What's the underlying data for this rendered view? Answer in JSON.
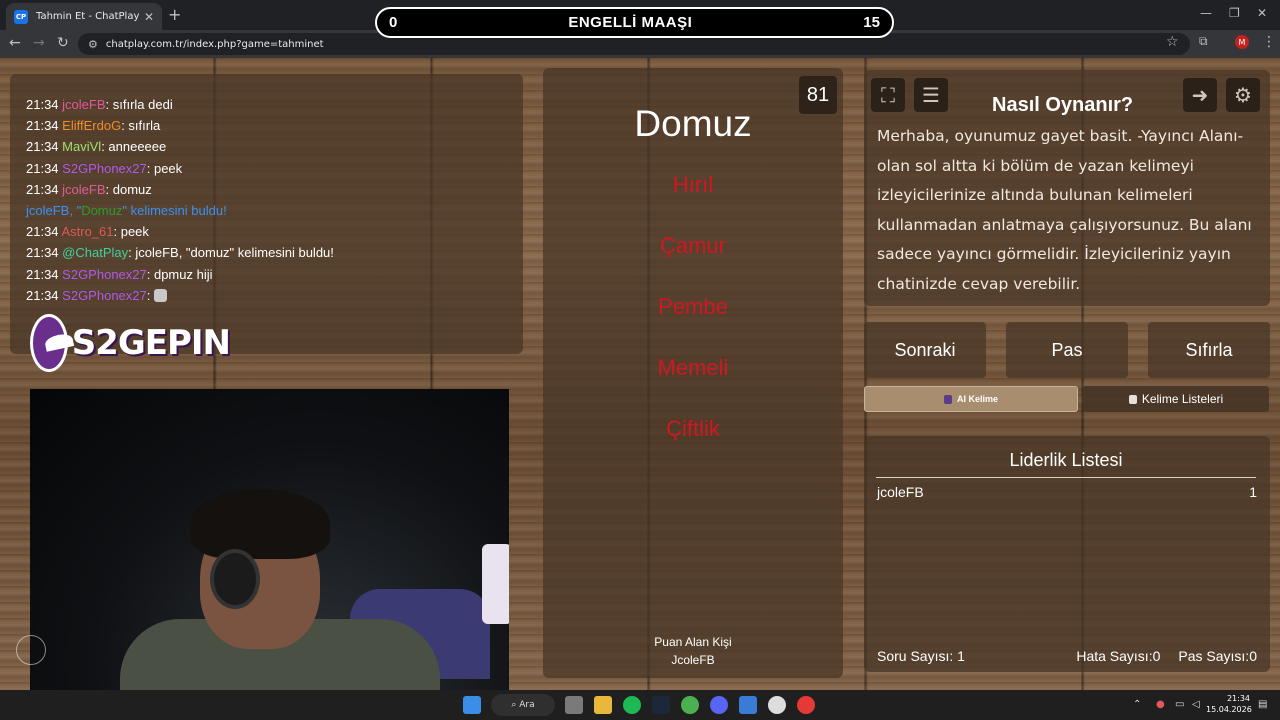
{
  "browser": {
    "tab_title": "Tahmin Et - ChatPlay",
    "tab_favicon": "CP",
    "url": "chatplay.com.tr/index.php?game=tahminet",
    "profile_initial": "M"
  },
  "banner": {
    "left_score": "0",
    "title": "ENGELLİ MAAŞI",
    "right_score": "15"
  },
  "chat": {
    "lines": [
      {
        "time": "21:34",
        "user": "jcoleFB",
        "color": "#e05a9a",
        "msg": ": sıfırla dedi"
      },
      {
        "time": "21:34",
        "user": "EliffErdoG",
        "color": "#f08c2a",
        "msg": ": sıfırla"
      },
      {
        "time": "21:34",
        "user": "MaviVl",
        "color": "#9fe070",
        "msg": ": anneeeee"
      },
      {
        "time": "21:34",
        "user": "S2GPhonex27",
        "color": "#b05ae8",
        "msg": ": peek"
      },
      {
        "time": "21:34",
        "user": "jcoleFB",
        "color": "#e05a9a",
        "msg": ": domuz"
      },
      {
        "system": true,
        "pre": "jcoleFB, \"",
        "word": "Domuz",
        "post": "\" kelimesini buldu!"
      },
      {
        "time": "21:34",
        "user": "Astro_61",
        "color": "#e05a5a",
        "msg": ": peek"
      },
      {
        "time": "21:34",
        "user": "@ChatPlay",
        "color": "#3fd0a0",
        "msg": ": jcoleFB, \"domuz\" kelimesini buldu!"
      },
      {
        "time": "21:34",
        "user": "S2GPhonex27",
        "color": "#b05ae8",
        "msg": ": dpmuz hiji"
      },
      {
        "time": "21:34",
        "user": "S2GPhonex27",
        "color": "#b05ae8",
        "msg": ": ",
        "emote": true
      }
    ]
  },
  "logo": {
    "text": "S2GEPIN"
  },
  "card": {
    "word": "Domuz",
    "timer": "81",
    "forbidden": [
      "Hırıl",
      "Çamur",
      "Pembe",
      "Memeli",
      "Çiftlik"
    ],
    "scorer_label": "Puan Alan Kişi",
    "scorer_name": "JcoleFB"
  },
  "howto": {
    "title": "Nasıl Oynanır?",
    "text": "Merhaba, oyunumuz gayet basit. -Yayıncı Alanı- olan sol altta ki bölüm de yazan kelimeyi izleyicilerinize altında bulunan kelimeleri kullanmadan anlatmaya çalışıyorsunuz. Bu alanı sadece yayıncı görmelidir. İzleyicileriniz yayın chatinizde cevap verebilir."
  },
  "buttons": {
    "next": "Sonraki",
    "pass": "Pas",
    "reset": "Sıfırla",
    "ai_word": "AI Kelime",
    "word_lists": "Kelime Listeleri"
  },
  "leaderboard": {
    "title": "Liderlik Listesi",
    "rows": [
      {
        "name": "jcoleFB",
        "score": "1"
      }
    ],
    "question_count_label": "Soru Sayısı:",
    "question_count": "1",
    "error_count_label": "Hata Sayısı:",
    "error_count": "0",
    "pass_count_label": "Pas Sayısı:",
    "pass_count": "0"
  },
  "taskbar": {
    "search_label": "Ara",
    "time": "21:34",
    "date": "15.04.2026"
  },
  "colors": {
    "forbidden": "#d11722",
    "system_msg": "#3e8ff0",
    "system_word": "#2e9b2e"
  }
}
